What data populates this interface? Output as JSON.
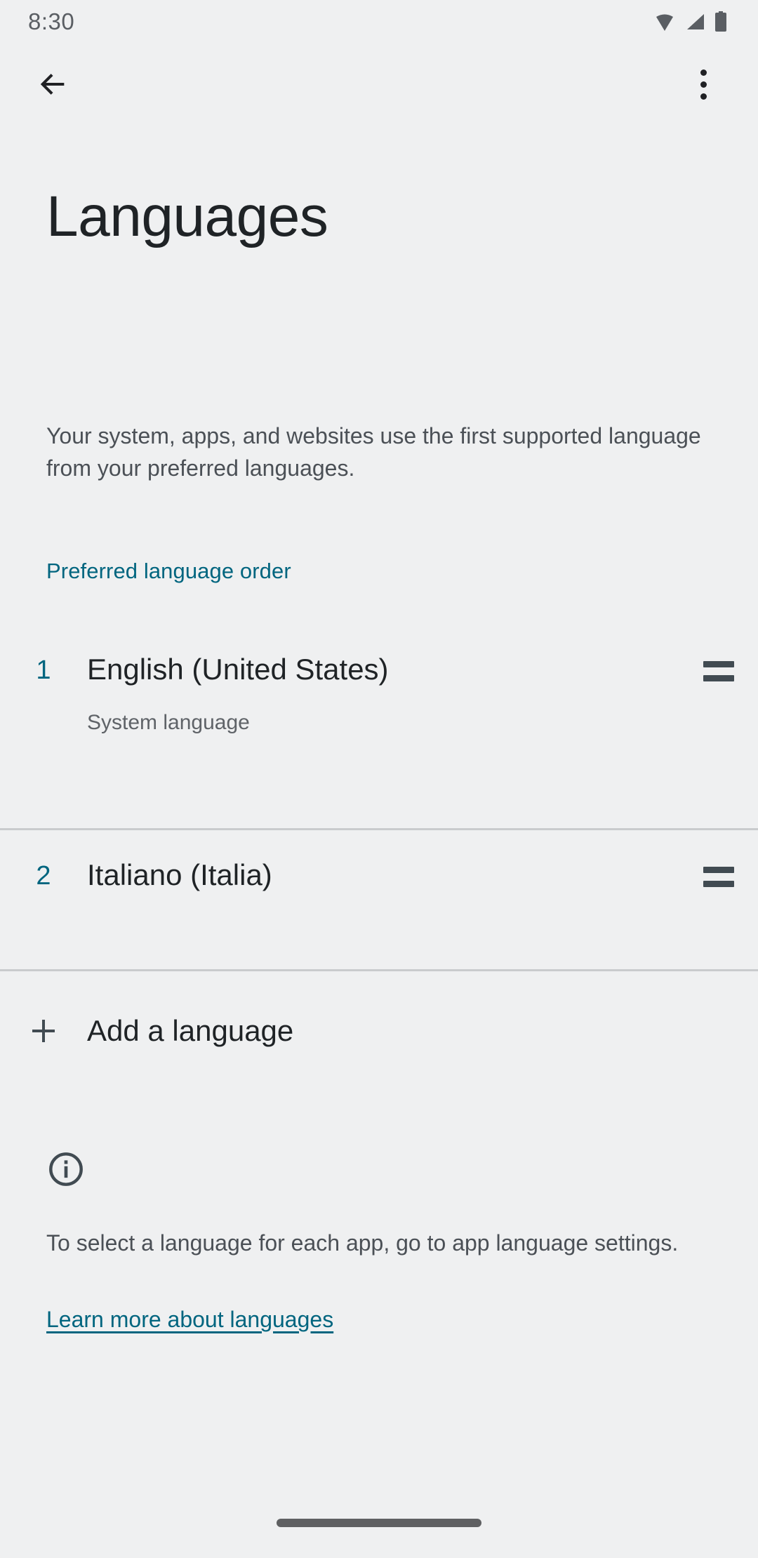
{
  "status_bar": {
    "time": "8:30",
    "icons": [
      "wifi-icon",
      "signal-icon",
      "battery-icon"
    ]
  },
  "app_bar": {
    "back_icon": "back-arrow-icon",
    "overflow_icon": "more-options-icon"
  },
  "page": {
    "title": "Languages",
    "intro": "Your system, apps, and websites use the first supported language from your preferred languages.",
    "section_header": "Preferred language order"
  },
  "languages": [
    {
      "order": "1",
      "name": "English (United States)",
      "subtitle": "System language",
      "handle_icon": "drag-handle-icon"
    },
    {
      "order": "2",
      "name": "Italiano (Italia)",
      "subtitle": "",
      "handle_icon": "drag-handle-icon"
    }
  ],
  "add_language": {
    "icon": "plus-icon",
    "label": "Add a language"
  },
  "footer": {
    "icon": "info-icon",
    "text": "To select a language for each app, go to app language settings.",
    "link": "Learn more about languages"
  },
  "nav": {
    "pill": "home-gesture-pill"
  },
  "colors": {
    "background": "#eff0f1",
    "accent": "#00657f",
    "primary_text": "#1f2326",
    "secondary_text": "#4b5056",
    "divider": "#c9cbcd"
  }
}
